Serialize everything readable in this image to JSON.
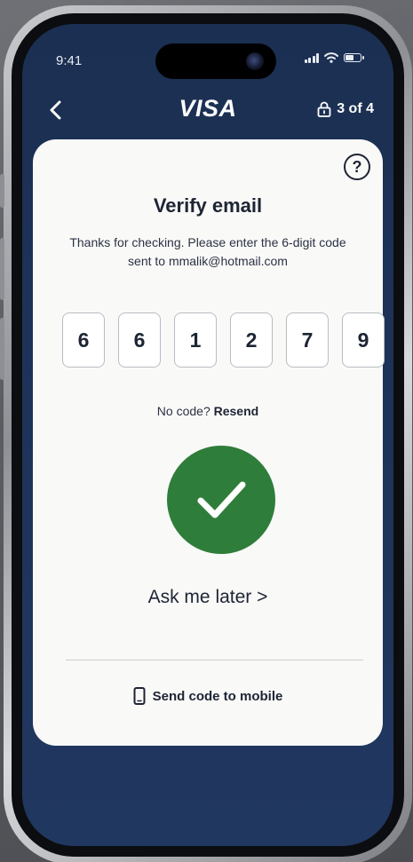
{
  "status_bar": {
    "time": "9:41",
    "icons": [
      "signal-icon",
      "wifi-icon",
      "battery-icon"
    ]
  },
  "nav": {
    "back_icon": "chevron-left-icon",
    "brand": "VISA",
    "lock_icon": "lock-icon",
    "step": "3 of 4"
  },
  "card": {
    "help_icon": "question-circle-icon",
    "help_glyph": "?",
    "title": "Verify email",
    "subtitle": "Thanks for checking. Please enter the 6-digit code sent to mmalik@hotmail.com",
    "code_digits": [
      "6",
      "6",
      "1",
      "2",
      "7",
      "9"
    ],
    "resend_prompt": "No code?",
    "resend_label": "Resend",
    "success_icon": "check-circle-icon",
    "success_color": "#2f7d3a",
    "ask_later": "Ask me later >",
    "mobile_icon": "mobile-phone-icon",
    "send_mobile": "Send code to mobile"
  },
  "colors": {
    "background_navy": "#1b2f52",
    "card": "#f9f9f8",
    "text_dark": "#1d2433"
  }
}
